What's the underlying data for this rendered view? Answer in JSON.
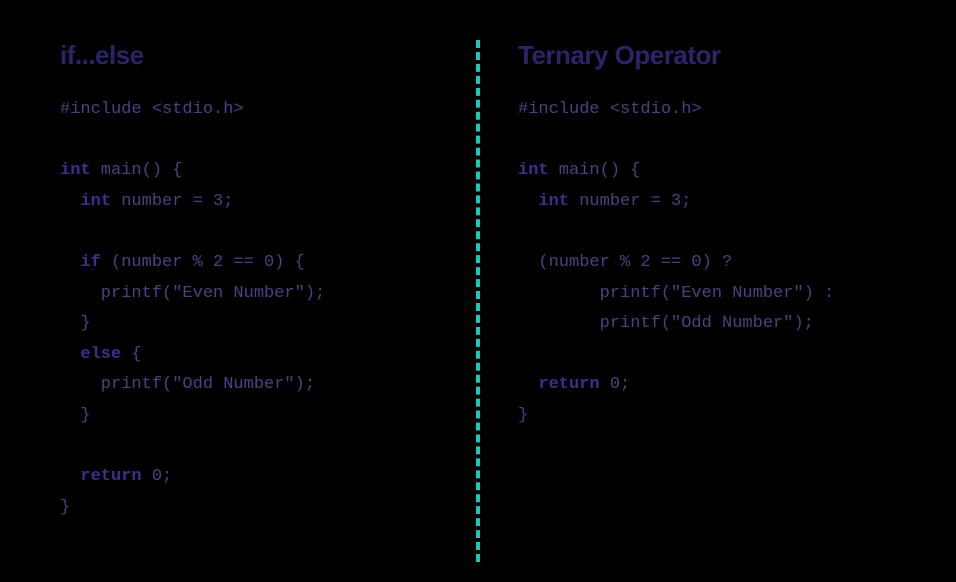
{
  "left": {
    "heading": "if...else",
    "code": {
      "l1": "#include <stdio.h>",
      "l2": "",
      "kw_int1": "int",
      "l3_rest": " main() {",
      "kw_int2": "int",
      "l4_rest": " number = 3;",
      "l5": "",
      "kw_if": "if",
      "l6_rest": " (number % 2 == 0) {",
      "l7": "    printf(\"Even Number\");",
      "l8": "  }",
      "kw_else": "else",
      "l9_rest": " {",
      "l10": "    printf(\"Odd Number\");",
      "l11": "  }",
      "l12": "",
      "kw_return": "return",
      "l13_rest": " 0;",
      "l14": "}"
    }
  },
  "right": {
    "heading": "Ternary Operator",
    "code": {
      "l1": "#include <stdio.h>",
      "l2": "",
      "kw_int1": "int",
      "l3_rest": " main() {",
      "kw_int2": "int",
      "l4_rest": " number = 3;",
      "l5": "",
      "l6": "  (number % 2 == 0) ?",
      "l7": "        printf(\"Even Number\") :",
      "l8": "        printf(\"Odd Number\");",
      "l9": "",
      "kw_return": "return",
      "l10_rest": " 0;",
      "l11": "}"
    }
  }
}
